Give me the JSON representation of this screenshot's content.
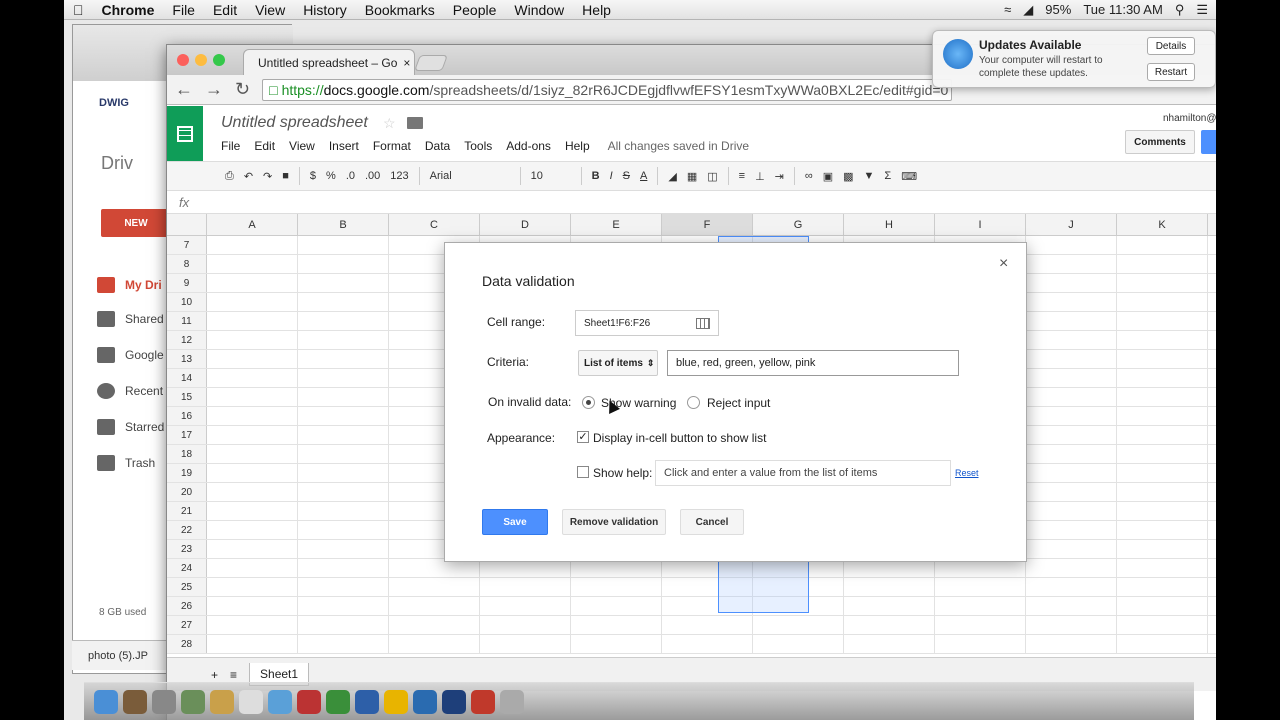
{
  "menubar": {
    "app": "Chrome",
    "items": [
      "File",
      "Edit",
      "View",
      "History",
      "Bookmarks",
      "People",
      "Window",
      "Help"
    ],
    "battery": "95%",
    "clock": "Tue 11:30 AM"
  },
  "browser": {
    "tab_title": "Untitled spreadsheet – Go",
    "url_scheme": "https://",
    "url_host": "docs.google.com",
    "url_path": "/spreadsheets/d/1siyz_82rR6JCDEgjdflvwfEFSY1esmTxyWWa0BXL2Ec/edit#gid=0"
  },
  "drive": {
    "logo_text": "DWIG",
    "title": "Driv",
    "new_label": "NEW",
    "nav": [
      "My Dri",
      "Shared",
      "Google",
      "Recent",
      "Starred",
      "Trash"
    ],
    "storage": "8 GB used",
    "download": "photo (5).JP"
  },
  "sheet": {
    "title": "Untitled spreadsheet",
    "menus": [
      "File",
      "Edit",
      "View",
      "Insert",
      "Format",
      "Data",
      "Tools",
      "Add-ons",
      "Help"
    ],
    "saved_status": "All changes saved in Drive",
    "user": "nhamilton@",
    "comments_label": "Comments",
    "toolbar": {
      "currency": "$",
      "percent": "%",
      "decimal_down": ".0",
      "decimal_up": ".00",
      "format": "123",
      "font": "Arial",
      "size": "10",
      "bold": "B",
      "italic": "I",
      "strike": "S",
      "sum": "Σ"
    },
    "fx": "fx",
    "columns": [
      "A",
      "B",
      "C",
      "D",
      "E",
      "F",
      "G",
      "H",
      "I",
      "J",
      "K"
    ],
    "selected_column": "F",
    "rows": [
      "7",
      "8",
      "9",
      "10",
      "11",
      "12",
      "13",
      "14",
      "15",
      "16",
      "17",
      "18",
      "19",
      "20",
      "21",
      "22",
      "23",
      "24",
      "25",
      "26",
      "27",
      "28"
    ],
    "sheet_tab": "Sheet1",
    "add_sheet": "+",
    "list_sheets": "≡"
  },
  "notification": {
    "title": "Updates Available",
    "message": "Your computer will restart to complete these updates.",
    "details": "Details",
    "restart": "Restart"
  },
  "dialog": {
    "title": "Data validation",
    "close": "×",
    "cell_range_label": "Cell range:",
    "cell_range_value": "Sheet1!F6:F26",
    "criteria_label": "Criteria:",
    "criteria_type": "List of items",
    "criteria_value": "blue, red, green, yellow, pink",
    "invalid_label": "On invalid data:",
    "show_warning": "Show warning",
    "reject_input": "Reject input",
    "appearance_label": "Appearance:",
    "display_button": "Display in-cell button to show list",
    "show_help": "Show help:",
    "help_text": "Click and enter a value from the list of items",
    "reset": "Reset",
    "save": "Save",
    "remove": "Remove validation",
    "cancel": "Cancel"
  }
}
